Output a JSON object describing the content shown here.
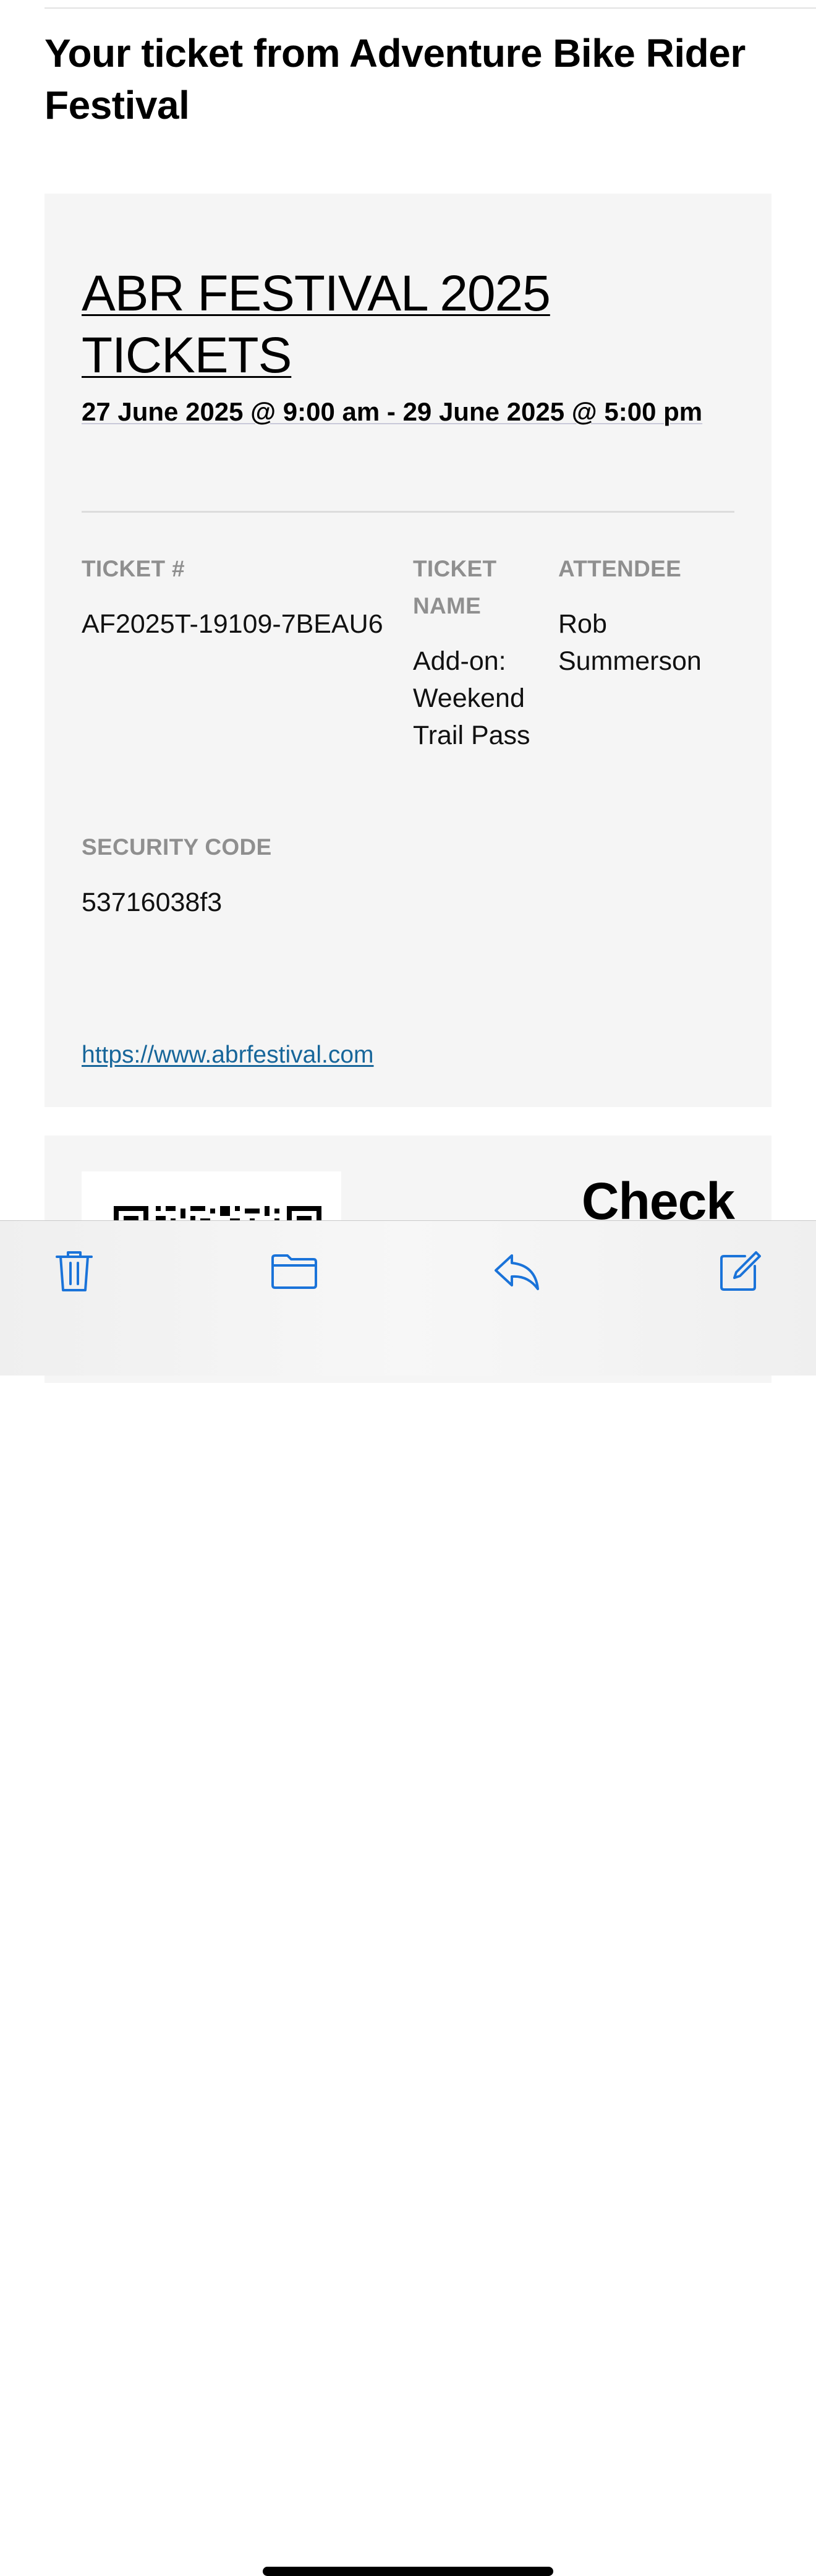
{
  "email": {
    "subject": "Your ticket from Adventure Bike Rider Festival"
  },
  "ticket": {
    "event_title": "ABR FESTIVAL 2025 TICKETS",
    "dates": "27 June 2025 @ 9:00 am - 29 June 2025 @ 5:00 pm",
    "ticket_number_label": "TICKET #",
    "ticket_number": "AF2025T-19109-7BEAU6",
    "ticket_name_label": "TICKET NAME",
    "ticket_name": "Add-on: Weekend Trail Pass",
    "attendee_label": "ATTENDEE",
    "attendee": "Rob Summerson",
    "security_code_label": "SECURITY CODE",
    "security_code": "53716038f3",
    "website": "https://www.abrfestival.com"
  },
  "checkin": {
    "heading": "Check"
  },
  "toolbar": {
    "icons": [
      "trash-icon",
      "folder-icon",
      "reply-icon",
      "compose-icon"
    ],
    "accent_color": "#1a73d9"
  }
}
